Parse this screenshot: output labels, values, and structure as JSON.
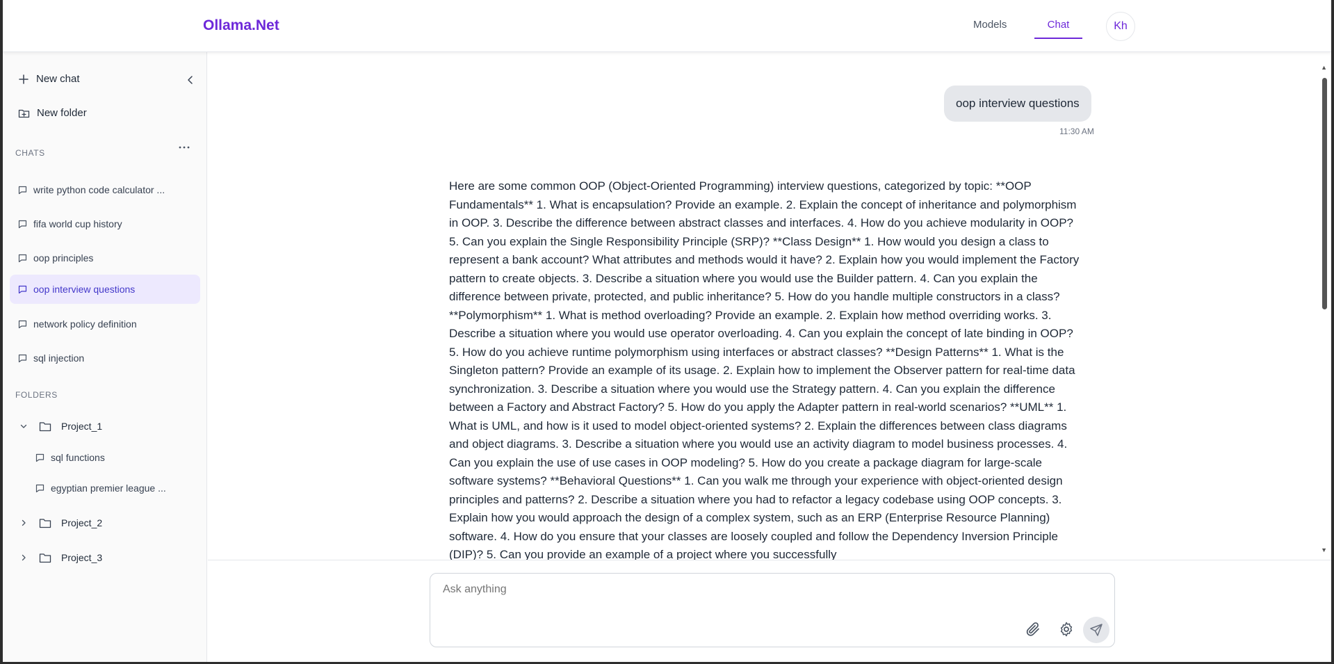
{
  "header": {
    "brand": "Ollama.Net",
    "nav": {
      "models": "Models",
      "chat": "Chat"
    },
    "avatar_initials": "Kh"
  },
  "sidebar": {
    "new_chat": "New chat",
    "new_folder": "New folder",
    "chats_title": "CHATS",
    "chats": [
      "write python code calculator ...",
      "fifa world cup history",
      "oop principles",
      "oop interview questions",
      "network policy definition",
      "sql injection"
    ],
    "folders_title": "FOLDERS",
    "folders": [
      {
        "name": "Project_1",
        "items": [
          "sql functions",
          "egyptian premier league ..."
        ]
      },
      {
        "name": "Project_2"
      },
      {
        "name": "Project_3"
      }
    ]
  },
  "conversation": {
    "user_message": "oop interview questions",
    "user_time": "11:30 AM",
    "assistant_message": "Here are some common OOP (Object-Oriented Programming) interview questions, categorized by topic: **OOP Fundamentals** 1. What is encapsulation? Provide an example. 2. Explain the concept of inheritance and polymorphism in OOP. 3. Describe the difference between abstract classes and interfaces. 4. How do you achieve modularity in OOP? 5. Can you explain the Single Responsibility Principle (SRP)? **Class Design** 1. How would you design a class to represent a bank account? What attributes and methods would it have? 2. Explain how you would implement the Factory pattern to create objects. 3. Describe a situation where you would use the Builder pattern. 4. Can you explain the difference between private, protected, and public inheritance? 5. How do you handle multiple constructors in a class? **Polymorphism** 1. What is method overloading? Provide an example. 2. Explain how method overriding works. 3. Describe a situation where you would use operator overloading. 4. Can you explain the concept of late binding in OOP? 5. How do you achieve runtime polymorphism using interfaces or abstract classes? **Design Patterns** 1. What is the Singleton pattern? Provide an example of its usage. 2. Explain how to implement the Observer pattern for real-time data synchronization. 3. Describe a situation where you would use the Strategy pattern. 4. Can you explain the difference between a Factory and Abstract Factory? 5. How do you apply the Adapter pattern in real-world scenarios? **UML** 1. What is UML, and how is it used to model object-oriented systems? 2. Explain the differences between class diagrams and object diagrams. 3. Describe a situation where you would use an activity diagram to model business processes. 4. Can you explain the use of use cases in OOP modeling? 5. How do you create a package diagram for large-scale software systems? **Behavioral Questions** 1. Can you walk me through your experience with object-oriented design principles and patterns? 2. Describe a situation where you had to refactor a legacy codebase using OOP concepts. 3. Explain how you would approach the design of a complex system, such as an ERP (Enterprise Resource Planning) software. 4. How do you ensure that your classes are loosely coupled and follow the Dependency Inversion Principle (DIP)? 5. Can you provide an example of a project where you successfully"
  },
  "composer": {
    "placeholder": "Ask anything"
  },
  "colors": {
    "accent": "#6d28d9",
    "active_bg": "#ede9fe"
  },
  "icons": [
    "plus-icon",
    "folder-plus-icon",
    "chevron-left-icon",
    "more-icon",
    "chat-bubble-icon",
    "folder-icon",
    "chevron-down-icon",
    "chevron-right-icon",
    "paperclip-icon",
    "gear-icon",
    "send-icon"
  ]
}
